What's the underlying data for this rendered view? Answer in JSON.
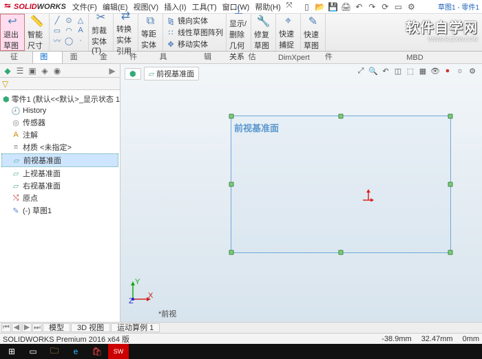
{
  "app": {
    "logo_text_1": "SOLID",
    "logo_text_2": "WORKS"
  },
  "menu": {
    "file": "文件(F)",
    "edit": "编辑(E)",
    "view": "视图(V)",
    "insert": "插入(I)",
    "tools": "工具(T)",
    "window": "窗口(W)",
    "help": "帮助(H)"
  },
  "doc_tab": "草图1 - 零件1",
  "ribbon": {
    "exit": "退出草图",
    "smart_dim": "智能尺寸",
    "trim": "剪裁实体(T)",
    "convert": "转换实体引用",
    "offset": "等距实体",
    "mirror": "镜向实体",
    "linear_pattern": "线性草图阵列",
    "move": "移动实体",
    "show_rel": "显示/删除几何关系",
    "repair": "修复草图",
    "quick_snap": "快速捕捉",
    "rapid": "快速草图"
  },
  "cmdtabs": {
    "feature": "特征",
    "sketch": "草图",
    "surface": "曲面",
    "sheetmetal": "钣金",
    "weldment": "焊件",
    "mold": "模具工具",
    "direct": "直接编辑",
    "evaluate": "评估",
    "dimxpert": "DimXpert",
    "swaddin": "SOLIDWORKS 插件",
    "swmbd": "SOLIDWORKS MBD"
  },
  "tree": {
    "root": "零件1 (默认<<默认>_显示状态 1>)",
    "history": "History",
    "sensors": "传感器",
    "annotations": "注解",
    "material": "材质 <未指定>",
    "front": "前视基准面",
    "top": "上视基准面",
    "right": "右视基准面",
    "origin": "原点",
    "sketch1": "(-) 草图1"
  },
  "breadcrumb": {
    "plane": "前视基准面"
  },
  "viewport": {
    "plane_label": "前视基准面",
    "footer": "*前视"
  },
  "bottom_tabs": {
    "model": "模型",
    "3dview": "3D 视图",
    "motion": "运动算例 1"
  },
  "status": {
    "version": "SOLIDWORKS Premium 2016 x64 版",
    "x": "-38.9mm",
    "y": "32.47mm",
    "z": "0mm"
  },
  "watermark": {
    "line1": "软件自学网",
    "line2": "WWW.RJZXW.COM"
  }
}
